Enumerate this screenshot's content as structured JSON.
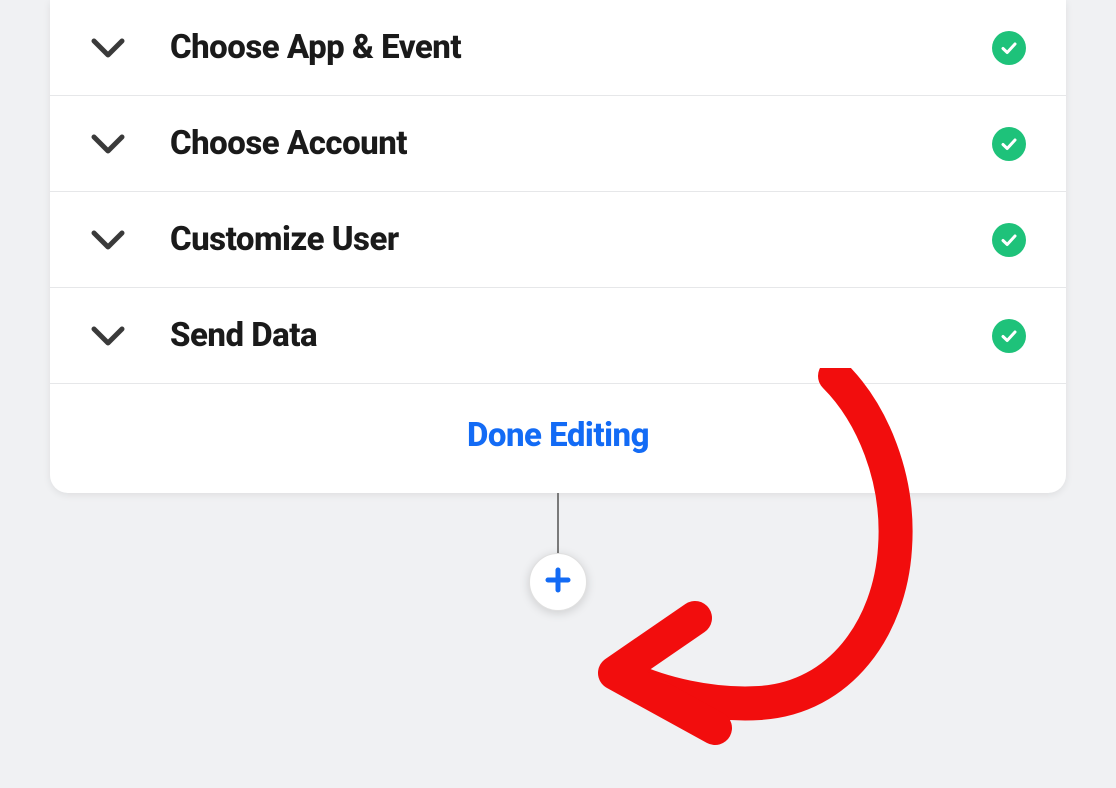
{
  "steps": [
    {
      "label": "Choose App & Event",
      "completed": true
    },
    {
      "label": "Choose Account",
      "completed": true
    },
    {
      "label": "Customize User",
      "completed": true
    },
    {
      "label": "Send Data",
      "completed": true
    }
  ],
  "footer": {
    "done_label": "Done Editing"
  },
  "colors": {
    "accent": "#136bf5",
    "success": "#1ec27a",
    "annotation": "#f20d0d"
  }
}
